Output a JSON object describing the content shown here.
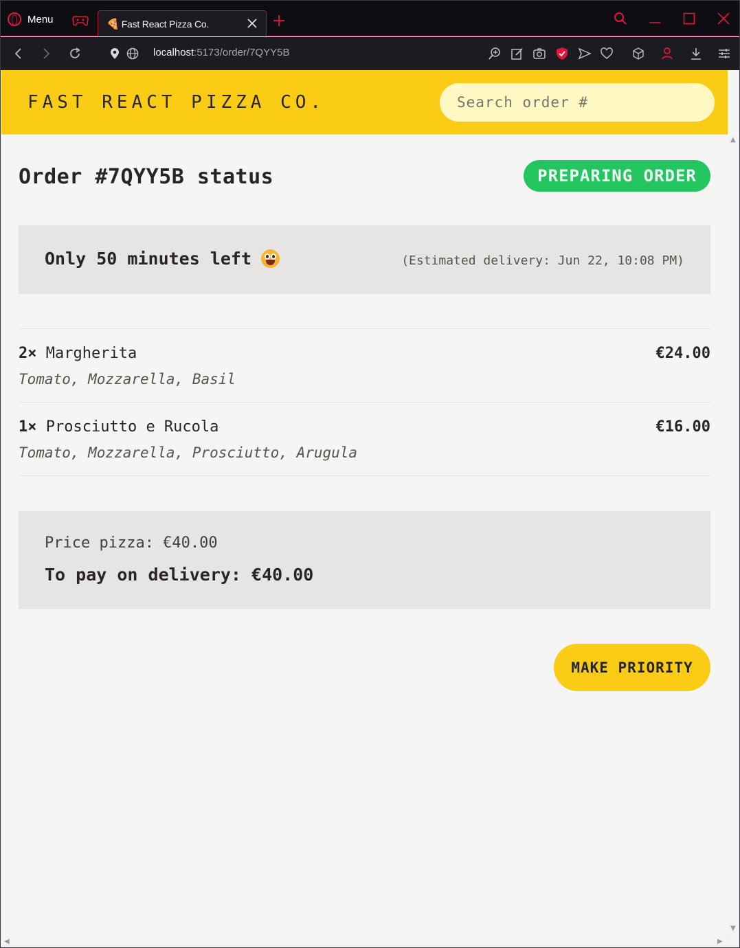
{
  "browser": {
    "menu_label": "Menu",
    "tab_title": "Fast React Pizza Co.",
    "url_host": "localhost",
    "url_path": ":5173/order/7QYY5B",
    "accent_color": "#e0173a"
  },
  "header": {
    "logo": "FAST REACT PIZZA CO.",
    "search_placeholder": "Search order #",
    "brand_color": "#facc15"
  },
  "order": {
    "title": "Order #7QYY5B status",
    "status_badge": "PREPARING ORDER",
    "status_color": "#22c55e",
    "eta_main": "Only 50 minutes left",
    "eta_sub": "(Estimated delivery: Jun 22, 10:08 PM)",
    "items": [
      {
        "qty": "2×",
        "name": "Margherita",
        "price": "€24.00",
        "ingredients": "Tomato, Mozzarella, Basil"
      },
      {
        "qty": "1×",
        "name": "Prosciutto e Rucola",
        "price": "€16.00",
        "ingredients": "Tomato, Mozzarella, Prosciutto, Arugula"
      }
    ],
    "price_pizza": "Price pizza: €40.00",
    "to_pay": "To pay on delivery: €40.00",
    "priority_button": "MAKE PRIORITY"
  }
}
